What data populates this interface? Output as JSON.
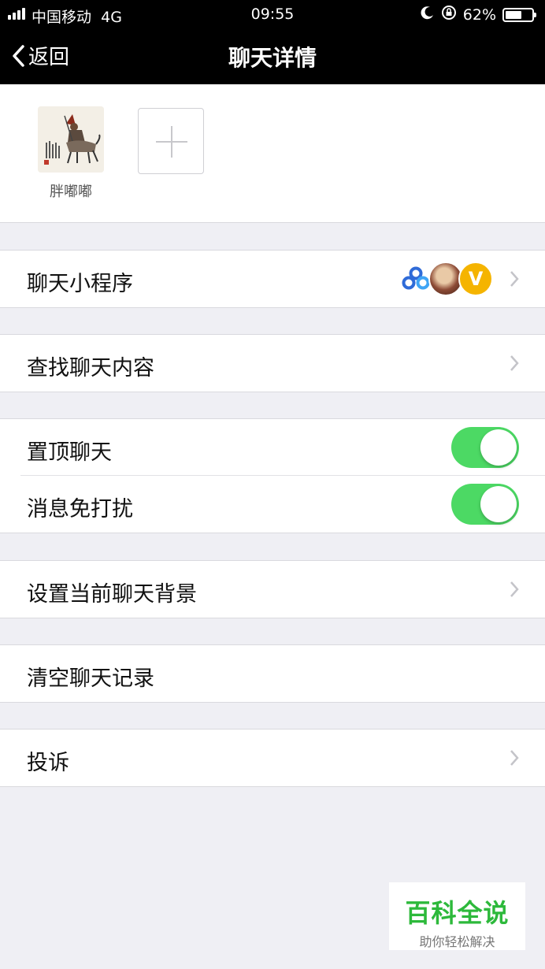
{
  "status_bar": {
    "carrier": "中国移动",
    "network": "4G",
    "time": "09:55",
    "battery": "62%",
    "battery_level": 0.62,
    "icons": [
      "signal-bars-icon",
      "moon-icon",
      "rotation-lock-icon",
      "battery-icon"
    ]
  },
  "nav": {
    "back_label": "返回",
    "title": "聊天详情"
  },
  "members": [
    {
      "name": "胖嘟嘟",
      "avatar": "painting-horse-rider-avatar"
    }
  ],
  "add_member_icon": "plus-icon",
  "menu": {
    "mini_programs": "聊天小程序",
    "search_history": "查找聊天内容",
    "sticky_on_top": "置顶聊天",
    "mute_notifications": "消息免打扰",
    "set_background": "设置当前聊天背景",
    "clear_history": "清空聊天记录",
    "report": "投诉"
  },
  "toggles": {
    "sticky_on_top": true,
    "mute_notifications": true
  },
  "mini_program_icons": [
    {
      "icon": "baidu-netdisk-icon"
    },
    {
      "icon": "game-hero-avatar-icon"
    },
    {
      "icon": "v-badge-icon",
      "letter": "V"
    }
  ],
  "watermark": {
    "title": "百科全说",
    "subtitle": "助你轻松解决"
  },
  "colors": {
    "nav_bg": "#000000",
    "page_bg": "#efeff4",
    "toggle_on": "#4cd964",
    "watermark_green": "#2db93b",
    "v_badge": "#f5b400"
  }
}
